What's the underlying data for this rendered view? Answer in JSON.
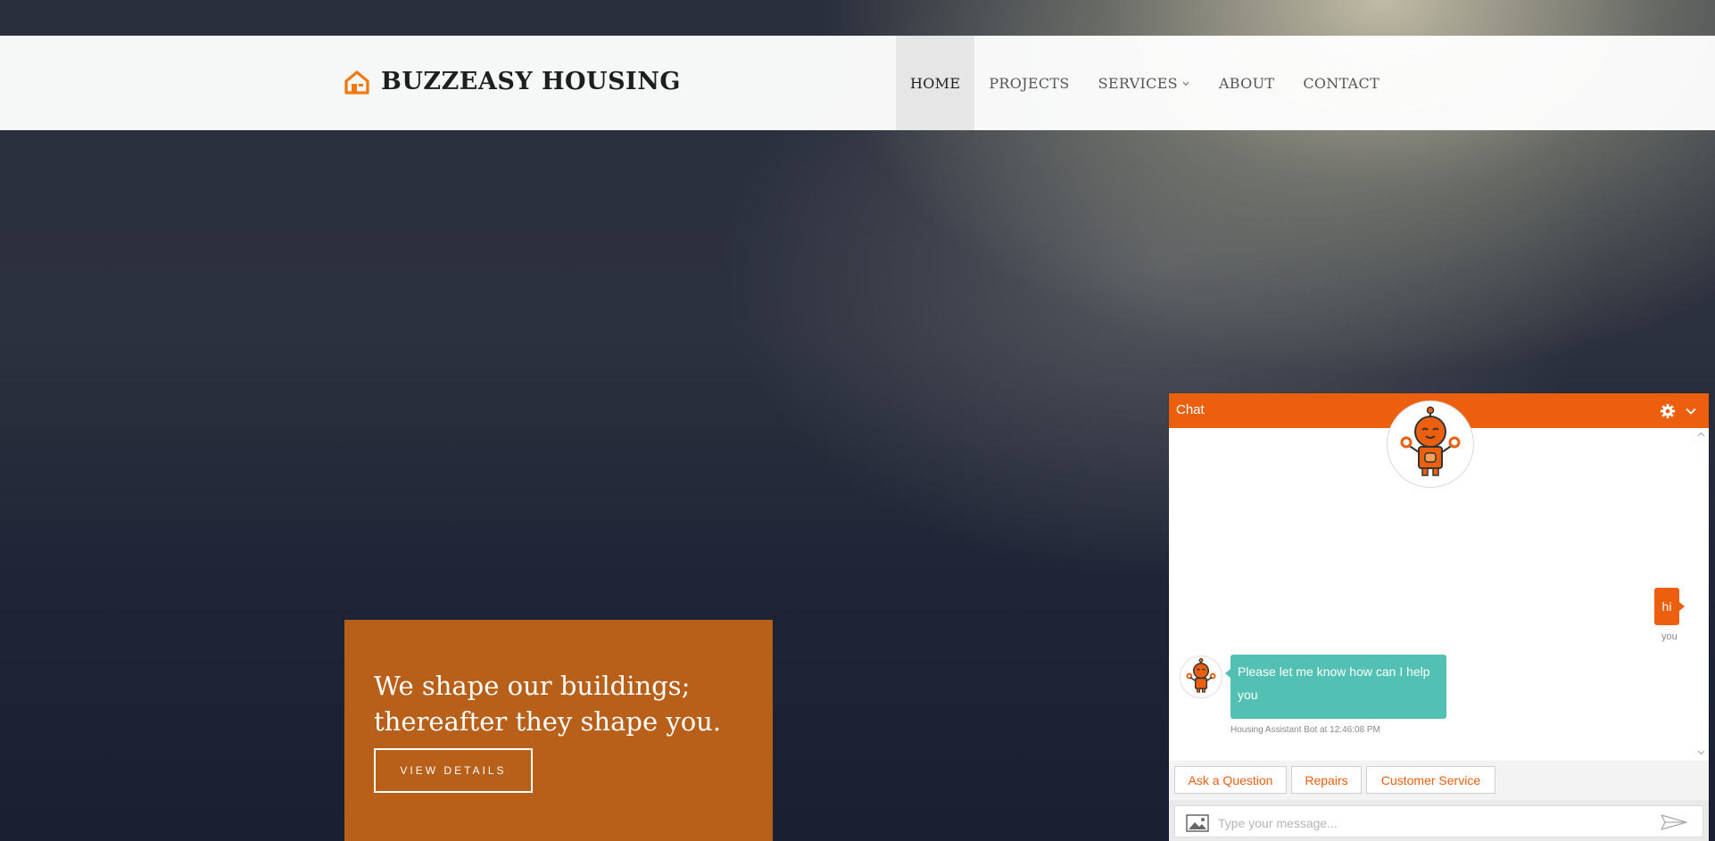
{
  "brand": {
    "name": "BUZZEASY HOUSING",
    "icon": "house-icon",
    "accent": "#f0780f"
  },
  "nav": {
    "items": [
      {
        "label": "HOME",
        "active": true
      },
      {
        "label": "PROJECTS"
      },
      {
        "label": "SERVICES",
        "has_dropdown": true
      },
      {
        "label": "ABOUT"
      },
      {
        "label": "CONTACT"
      }
    ]
  },
  "hero": {
    "line1": "We shape our buildings;",
    "line2": "thereafter they shape you.",
    "button_label": "VIEW DETAILS",
    "card_color": "#b8601a"
  },
  "chat": {
    "title": "Chat",
    "header_color": "#ec5f0f",
    "messages": [
      {
        "from": "user",
        "text": "hi",
        "label": "you"
      },
      {
        "from": "bot",
        "text": "Please let me know how can I help you",
        "meta": "Housing Assistant Bot at 12:46:08 PM"
      }
    ],
    "quick_replies": [
      "Ask a Question",
      "Repairs",
      "Customer Service"
    ],
    "input": {
      "placeholder": "Type your message...",
      "value": ""
    }
  }
}
